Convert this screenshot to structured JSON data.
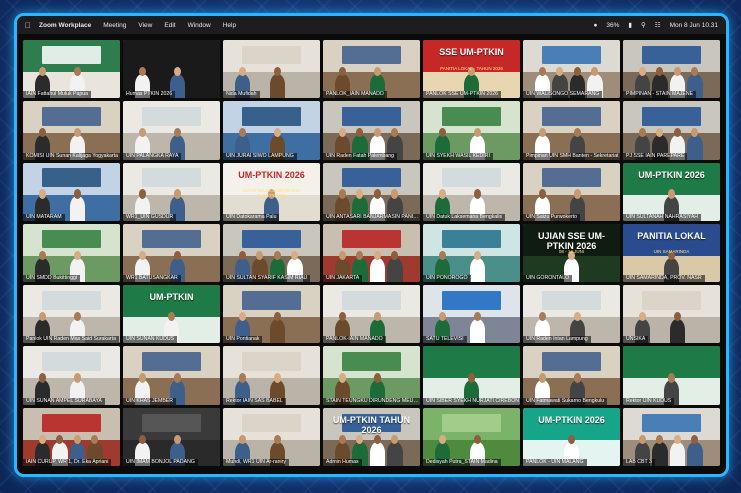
{
  "menubar": {
    "app_name": "Zoom Workplace",
    "menus": [
      "Meeting",
      "View",
      "Edit",
      "Window",
      "Help"
    ],
    "battery": "36%",
    "clock": "Mon 8 Jun  10.31"
  },
  "tiles": [
    {
      "label": "IAIN Fattahul Muluk Papua",
      "theme": "green-screen"
    },
    {
      "label": "Humas PTKIN 2026",
      "theme": "dark-avatar"
    },
    {
      "label": "Nida Mufidah",
      "theme": "room-light"
    },
    {
      "label": "PANLOK_IAIN MANADO",
      "theme": "office"
    },
    {
      "label": "PANLOK SSE UM-PTKIN 2026",
      "theme": "banner-red",
      "big": "SSE UM-PTKIN",
      "sub": "PANITIA LOKAL · TAHUN 2026"
    },
    {
      "label": "UIN WALISONGO SEMARANG",
      "theme": "hall"
    },
    {
      "label": "PIMPINAN - STAIN MAJENE",
      "theme": "hall-screen"
    },
    {
      "label": "KOMISI UIN Sunan Kalijaga Yogyakarta",
      "theme": "office"
    },
    {
      "label": "UIN PALANGKA RAYA",
      "theme": "room-white"
    },
    {
      "label": "UIN JURAI SIWO LAMPUNG",
      "theme": "room-blue"
    },
    {
      "label": "UIN Raden Fatah Palembang",
      "theme": "hall-screen"
    },
    {
      "label": "UIN SYEKH WASIL KEDIRI",
      "theme": "room-green"
    },
    {
      "label": "Pimpinan UIN SMH Banten - Sekretariat",
      "theme": "office"
    },
    {
      "label": "PJ SSE IAIN PAREPARE",
      "theme": "hall-screen"
    },
    {
      "label": "UIN MATARAM",
      "theme": "room-blue"
    },
    {
      "label": "WR1_UIN GUSDUR",
      "theme": "room-white"
    },
    {
      "label": "UIN Datokarama Palu",
      "theme": "banner-white",
      "big": "UM-PTKIN 2026",
      "sub": "UJIAN SELEKSI BERBASIS ELEKTRONIK"
    },
    {
      "label": "UIN ANTASARI BANJARMASIN PANITIA",
      "theme": "hall-screen"
    },
    {
      "label": "UIN Datuk Laksemana Bengkalis",
      "theme": "room-white"
    },
    {
      "label": "UIN Saizu Purwokerto",
      "theme": "office"
    },
    {
      "label": "UIN SULTANAH NAHRASIYAH",
      "theme": "banner-green",
      "big": "UM-PTKIN 2026",
      "sub": ""
    },
    {
      "label": "UIN SMDD Bukittinggi",
      "theme": "room-green"
    },
    {
      "label": "WR1 BATUSANGKAR",
      "theme": "office"
    },
    {
      "label": "UIN SULTAN SYARIF KASIM RIAU",
      "theme": "hall-screen"
    },
    {
      "label": "UIN JAKARTA",
      "theme": "hall-red"
    },
    {
      "label": "UIN PONOROGO",
      "theme": "room-teal"
    },
    {
      "label": "UIN GORONTALO",
      "theme": "banner-dark",
      "big": "UJIAN SSE UM-PTKIN 2026",
      "sub": "08 - 14 JUNI"
    },
    {
      "label": "UIN SAMARINDA, PROV. NASR",
      "theme": "banner-blue",
      "big": "PANITIA LOKAL",
      "sub": "UIN SAMARINDA"
    },
    {
      "label": "Panlok UIN Raden Mas Said Surakarta",
      "theme": "room-white"
    },
    {
      "label": "UIN SUNAN KUDUS",
      "theme": "banner-green",
      "big": "UM-PTKIN",
      "sub": ""
    },
    {
      "label": "UIN Pontianak",
      "theme": "office"
    },
    {
      "label": "PANLOK-IAIN MANADO",
      "theme": "room-white"
    },
    {
      "label": "SATU TELEVISI",
      "theme": "screen-blue"
    },
    {
      "label": "UIN Raden Intan Lampung",
      "theme": "room-white"
    },
    {
      "label": "UNSIKA",
      "theme": "room-light"
    },
    {
      "label": "UIN SUNAN AMPEL SURABAYA",
      "theme": "room-white"
    },
    {
      "label": "UIN KHAS JEMBER",
      "theme": "office"
    },
    {
      "label": "Rektor IAIN SAS BABEL",
      "theme": "room-light"
    },
    {
      "label": "STAIN TEUNGKU DIRUNDENG MEULABOH",
      "theme": "room-green"
    },
    {
      "label": "UIN SIBER SYEKH NURJATI CIREBON",
      "theme": "banner-green",
      "big": "",
      "sub": ""
    },
    {
      "label": "UIN Fatmawati Sukarno Bengkulu",
      "theme": "office"
    },
    {
      "label": "Rektor UIN KUDUS",
      "theme": "banner-green",
      "big": "",
      "sub": ""
    },
    {
      "label": "IAIN CURUP, WR 1, Dr. Eka Apriani",
      "theme": "hall-red"
    },
    {
      "label": "UIN IMAM BONJOL PADANG",
      "theme": "room-dark"
    },
    {
      "label": "Muhdi, WR1 UIN Ar-raniry",
      "theme": "room-light"
    },
    {
      "label": "Admin Humas",
      "theme": "hall-screen",
      "big": "UM-PTKIN TAHUN 2026",
      "sub": ""
    },
    {
      "label": "Dedisyah Putra_STAIN Madina",
      "theme": "outdoor"
    },
    {
      "label": "PANLOK - UIN MALANG",
      "theme": "banner-teal",
      "big": "UM-PTKIN 2026",
      "sub": ""
    },
    {
      "label": "LAB CBT 3",
      "theme": "hall"
    }
  ]
}
